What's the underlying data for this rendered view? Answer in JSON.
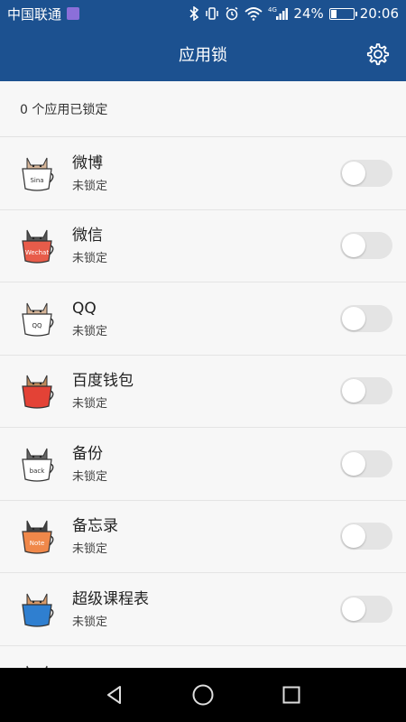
{
  "status_bar": {
    "carrier": "中国联通",
    "network": "4G",
    "battery_percent_text": "24%",
    "battery_level": 0.24,
    "time": "20:06",
    "icons": [
      "bluetooth-icon",
      "vibrate-icon",
      "alarm-icon",
      "wifi-icon",
      "signal-icon",
      "battery-icon"
    ]
  },
  "header": {
    "title": "应用锁",
    "settings_icon": "gear-icon"
  },
  "summary": {
    "text": "0 个应用已锁定"
  },
  "apps": [
    {
      "name": "微博",
      "status": "未锁定",
      "icon_label": "Sina",
      "locked": false,
      "cup_color": "#ffffff",
      "cat_color": "#d8b79a"
    },
    {
      "name": "微信",
      "status": "未锁定",
      "icon_label": "Wechat",
      "locked": false,
      "cup_color": "#e85c4a",
      "cat_color": "#555555"
    },
    {
      "name": "QQ",
      "status": "未锁定",
      "icon_label": "QQ",
      "locked": false,
      "cup_color": "#ffffff",
      "cat_color": "#d8b79a"
    },
    {
      "name": "百度钱包",
      "status": "未锁定",
      "icon_label": "",
      "locked": false,
      "cup_color": "#e34236",
      "cat_color": "#c08a5a"
    },
    {
      "name": "备份",
      "status": "未锁定",
      "icon_label": "back",
      "locked": false,
      "cup_color": "#ffffff",
      "cat_color": "#666666"
    },
    {
      "name": "备忘录",
      "status": "未锁定",
      "icon_label": "Note",
      "locked": false,
      "cup_color": "#f0884a",
      "cat_color": "#444444"
    },
    {
      "name": "超级课程表",
      "status": "未锁定",
      "icon_label": "",
      "locked": false,
      "cup_color": "#2f7fd0",
      "cat_color": "#d89a6a"
    },
    {
      "name": "电子邮件",
      "status": "",
      "icon_label": "",
      "locked": false,
      "cup_color": "#ffffff",
      "cat_color": "#888888"
    }
  ],
  "nav_bar": {
    "buttons": [
      "back-icon",
      "home-icon",
      "recents-icon"
    ]
  },
  "colors": {
    "primary": "#1c5190",
    "background": "#f7f7f7",
    "toggle_off": "#e4e4e4"
  }
}
